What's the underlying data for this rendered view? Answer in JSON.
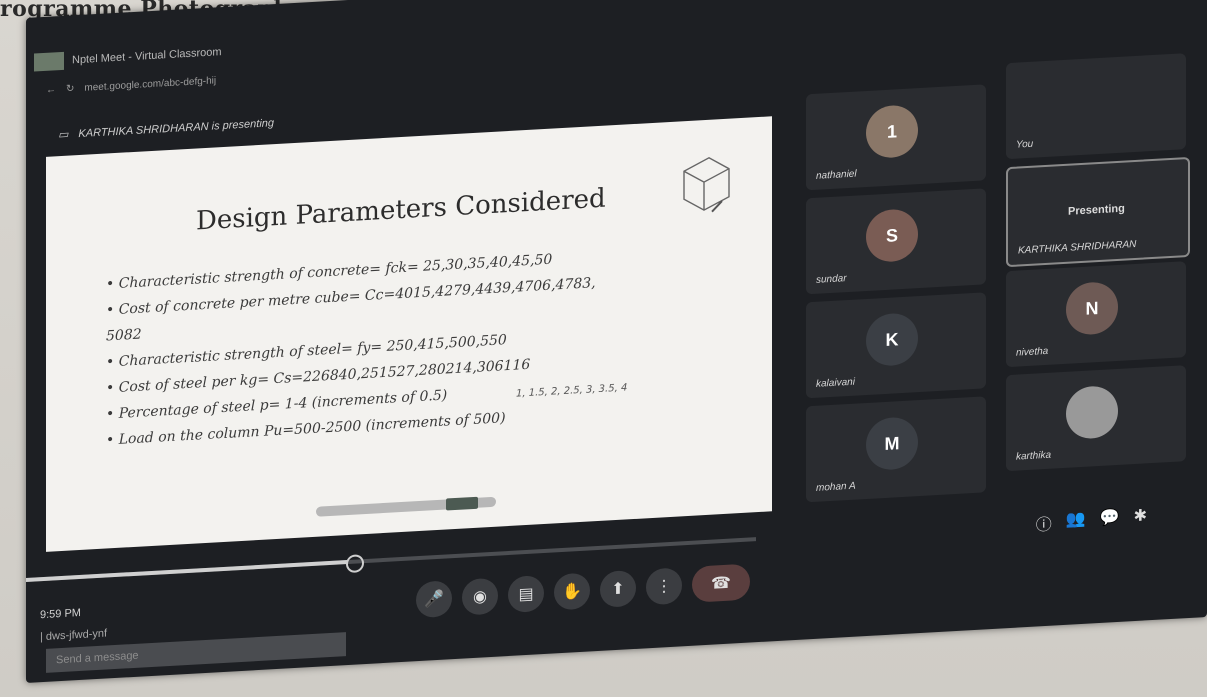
{
  "paper": {
    "header": "rogramme Photographs:"
  },
  "browser": {
    "tab_title": "Nptel Meet - Virtual Classroom",
    "address": "meet.google.com/abc-defg-hij"
  },
  "meeting": {
    "presenting_label": "KARTHIKA SHRIDHARAN is presenting"
  },
  "slide": {
    "title": "Design Parameters Considered",
    "bullets": [
      "Characteristic strength of concrete= fck= 25,30,35,40,45,50",
      "Cost of concrete per metre cube= Cc=4015,4279,4439,4706,4783,",
      "5082",
      "Characteristic strength of steel= fy= 250,415,500,550",
      "Cost of steel per kg= Cs=226840,251527,280214,306116",
      "Percentage of steel p= 1-4 (increments of 0.5)",
      "Load on the column Pu=500-2500 (increments of 500)"
    ],
    "handwritten_note": "1, 1.5, 2, 2.5, 3, 3.5, 4"
  },
  "participants": [
    {
      "initial": "1",
      "name": "nathaniel",
      "color": "#8a7768"
    },
    {
      "initial": "S",
      "name": "sundar",
      "color": "#7a5c54"
    },
    {
      "initial": "K",
      "name": "kalaivani",
      "color": "#3b3f45"
    },
    {
      "initial": "M",
      "name": "mohan A",
      "color": "#3b3f45"
    },
    {
      "initial": "",
      "name": "karthika",
      "color": "#3b3f45"
    },
    {
      "initial": "N",
      "name": "nivetha",
      "color": "#6e5a55"
    },
    {
      "initial": "",
      "name": "You",
      "color": "#888888"
    }
  ],
  "pinned_tile": {
    "title": "Presenting",
    "name": "KARTHIKA SHRIDHARAN"
  },
  "footer": {
    "time": "9:59 PM",
    "code": "| dws-jfwd-ynf",
    "chat_placeholder": "Send a message"
  },
  "icons": {
    "mic": "mic-icon",
    "camera": "camera-icon",
    "captions": "captions-icon",
    "hand": "raise-hand-icon",
    "present": "present-icon",
    "more": "more-icon",
    "end": "end-call-icon",
    "info": "info-icon",
    "people": "people-icon",
    "chat": "chat-icon",
    "activities": "activities-icon"
  }
}
